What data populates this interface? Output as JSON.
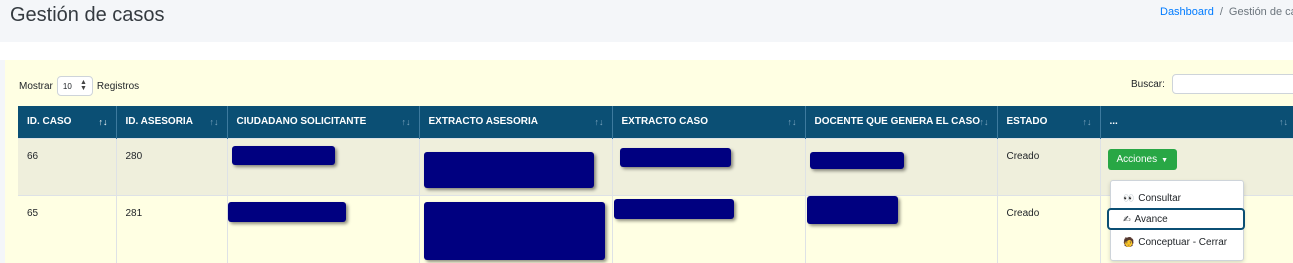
{
  "header": {
    "title": "Gestión de casos",
    "breadcrumb": {
      "home": "Dashboard",
      "separator": "/",
      "current": "Gestión de casos"
    }
  },
  "length_control": {
    "prefix": "Mostrar",
    "value": "10",
    "suffix": "Registros"
  },
  "search": {
    "label": "Buscar:",
    "value": ""
  },
  "table": {
    "columns": [
      "ID. CASO",
      "ID. ASESORIA",
      "CIUDADANO SOLICITANTE",
      "EXTRACTO ASESORIA",
      "EXTRACTO CASO",
      "DOCENTE QUE GENERA EL CASO",
      "ESTADO",
      "..."
    ],
    "rows": [
      {
        "id_caso": "66",
        "id_asesoria": "280",
        "estado": "Creado",
        "action_label": "Acciones"
      },
      {
        "id_caso": "65",
        "id_asesoria": "281",
        "estado": "Creado"
      }
    ]
  },
  "actions_menu": {
    "items": [
      {
        "label": "Consultar",
        "icon": "eyes-icon"
      },
      {
        "label": "Avance",
        "icon": "writing-hand-icon"
      },
      {
        "label": "Conceptuar - Cerrar",
        "icon": "person-icon"
      }
    ]
  },
  "colors": {
    "header_bg": "#0b4f74",
    "card_bg": "#ffffe3",
    "redaction": "#000080",
    "action_button": "#28a745",
    "link": "#007bff"
  }
}
